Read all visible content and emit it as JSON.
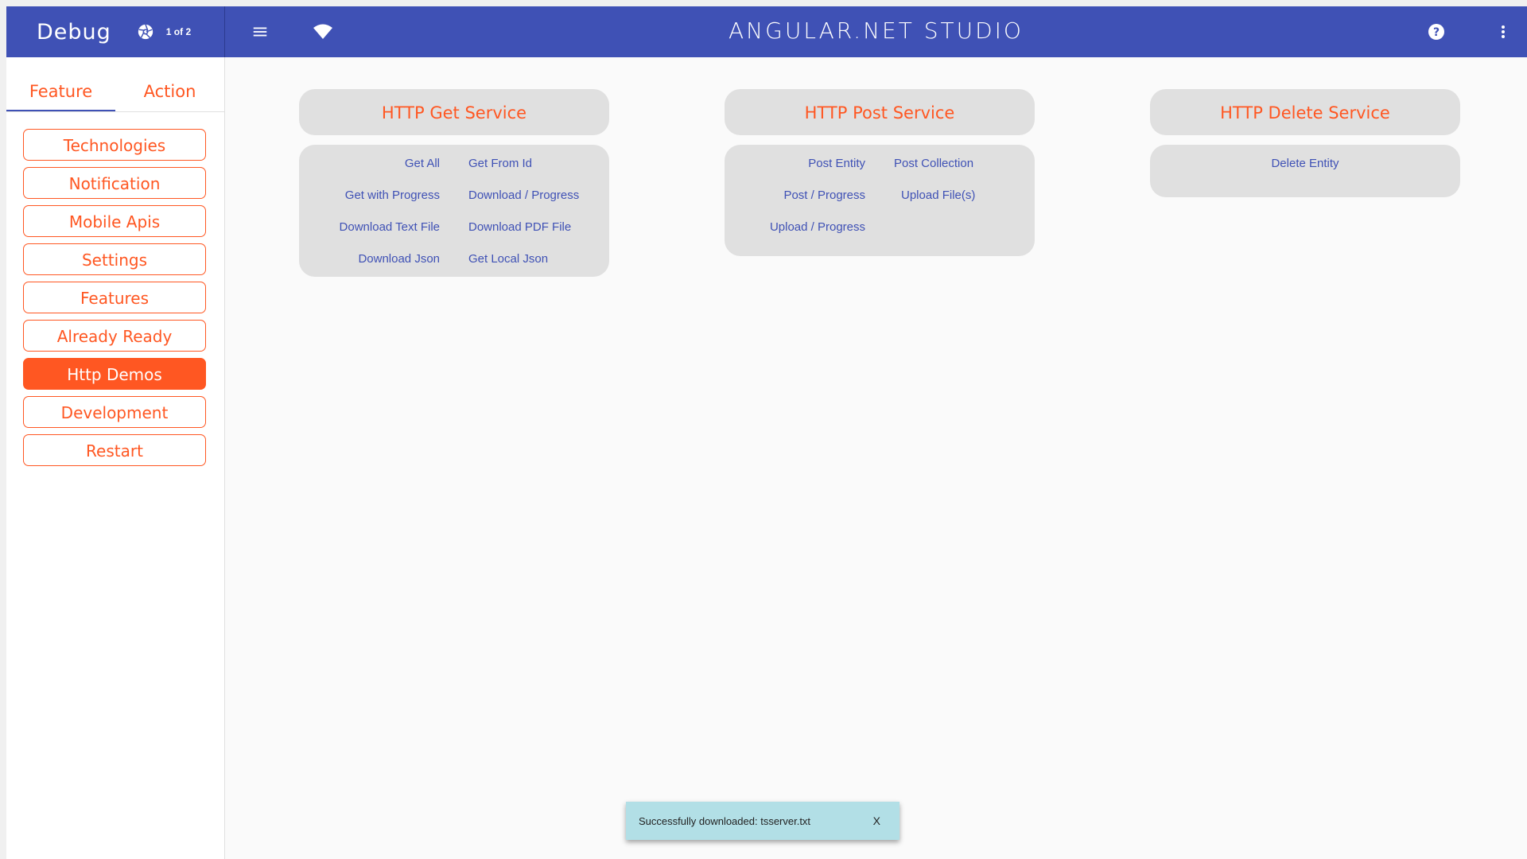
{
  "header": {
    "left_title": "Debug",
    "page_indicator": "1 of 2",
    "app_title": "ANGULAR.NET STUDIO",
    "icons": [
      "aperture-icon",
      "menu-icon",
      "wifi-icon",
      "help-icon",
      "more-vert-icon"
    ]
  },
  "sidebar": {
    "tabs": [
      {
        "label": "Feature",
        "active": true
      },
      {
        "label": "Action",
        "active": false
      }
    ],
    "items": [
      {
        "label": "Technologies"
      },
      {
        "label": "Notification"
      },
      {
        "label": "Mobile Apis"
      },
      {
        "label": "Settings"
      },
      {
        "label": "Features"
      },
      {
        "label": "Already Ready"
      },
      {
        "label": "Http Demos",
        "active": true
      },
      {
        "label": "Development"
      },
      {
        "label": "Restart"
      }
    ]
  },
  "services": {
    "get": {
      "title": "HTTP Get Service",
      "links": [
        "Get All",
        "Get From Id",
        "Get with Progress",
        "Download / Progress",
        "Download Text File",
        "Download PDF File",
        "Download Json",
        "Get Local Json"
      ]
    },
    "post": {
      "title": "HTTP Post Service",
      "links": [
        "Post Entity",
        "Post Collection",
        "Post / Progress",
        "Upload File(s)",
        "Upload / Progress"
      ]
    },
    "delete": {
      "title": "HTTP Delete Service",
      "links": [
        "Delete Entity"
      ]
    }
  },
  "snackbar": {
    "message": "Successfully downloaded: tsserver.txt",
    "close_label": "X"
  },
  "colors": {
    "primary": "#3f51b5",
    "accent": "#ff5722",
    "card": "#e0e0e0",
    "snackbar": "#b2dfe6"
  }
}
